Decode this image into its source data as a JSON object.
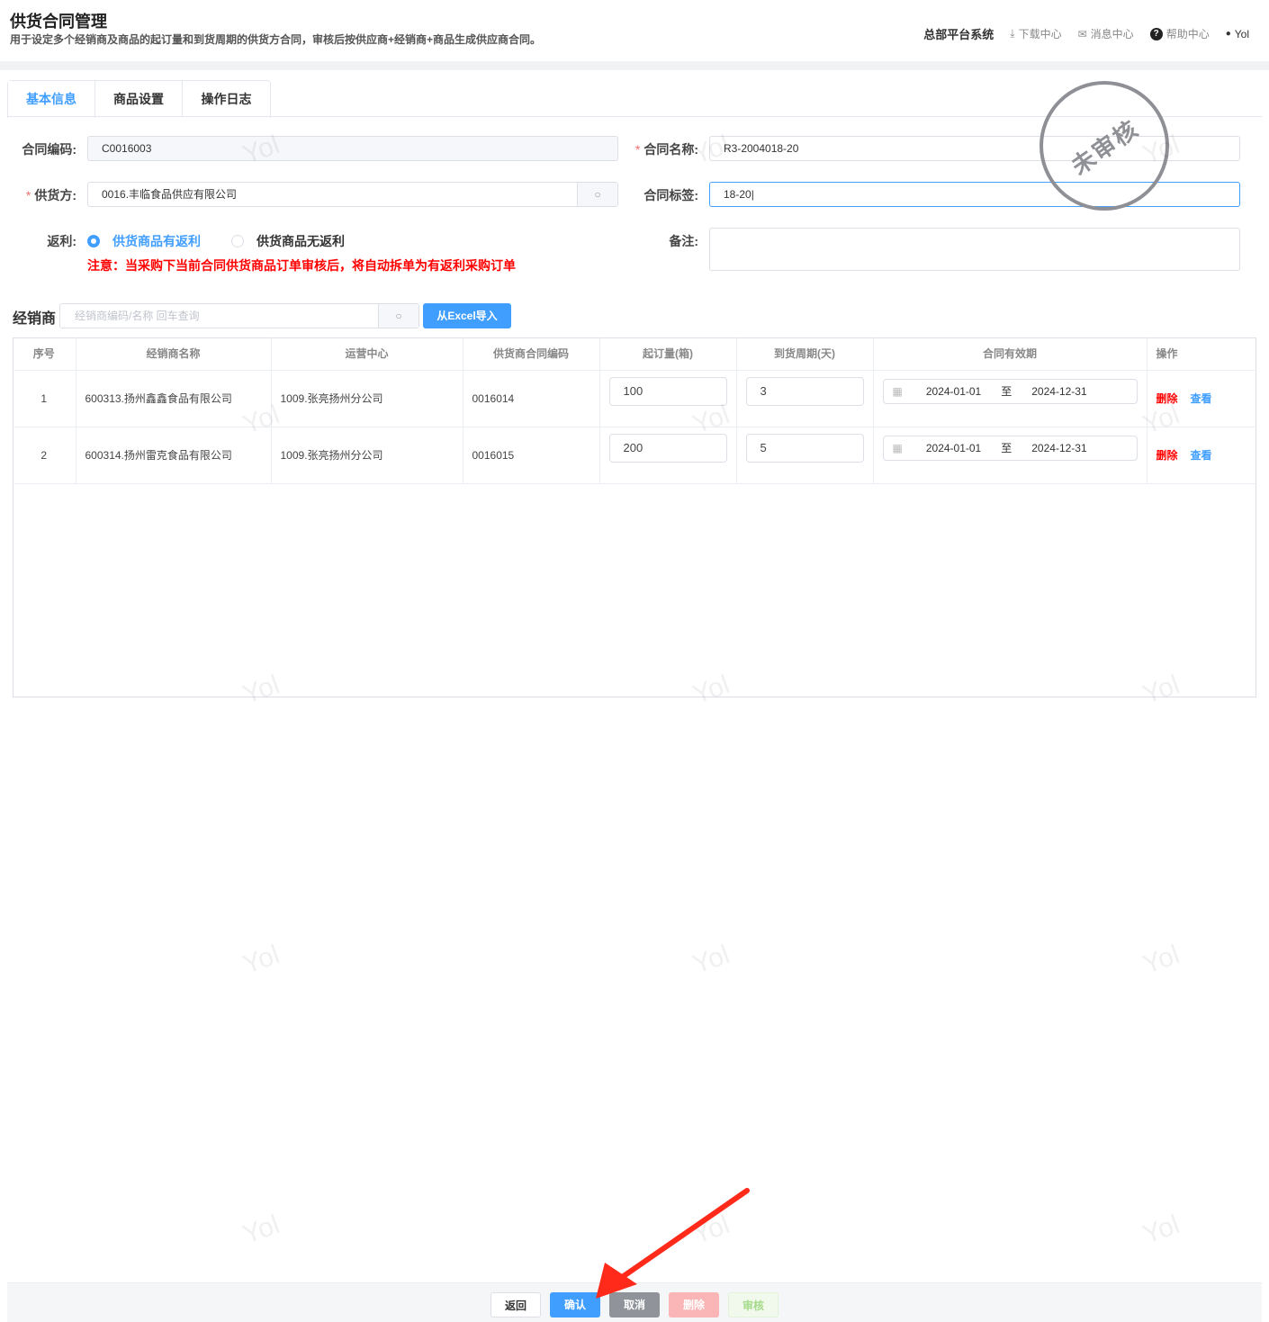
{
  "header": {
    "title": "供货合同管理",
    "subtitle": "用于设定多个经销商及商品的起订量和到货周期的供货方合同，审核后按供应商+经销商+商品生成供应商合同。",
    "system": "总部平台系统",
    "download": "下载中心",
    "messages": "消息中心",
    "help": "帮助中心",
    "user": "Yol"
  },
  "tabs": [
    "基本信息",
    "商品设置",
    "操作日志"
  ],
  "form": {
    "contract_code_label": "合同编码:",
    "contract_code": "C0016003",
    "contract_name_label": "合同名称:",
    "contract_name": "R3-2004018-20",
    "supplier_label": "供货方:",
    "supplier": "0016.丰临食品供应有限公司",
    "tag_label": "合同标签:",
    "tag": "18-20|",
    "rebate_label": "返利:",
    "rebate_yes": "供货商品有返利",
    "rebate_no": "供货商品无返利",
    "remark_label": "备注:",
    "remark": "",
    "note": "注意：当采购下当前合同供货商品订单审核后，将自动拆单为有返利采购订单"
  },
  "stamp": "未审核",
  "dealers": {
    "title": "经销商",
    "search_placeholder": "经销商编码/名称 回车查询",
    "import": "从Excel导入",
    "columns": [
      "序号",
      "经销商名称",
      "运营中心",
      "供货商合同编码",
      "起订量(箱)",
      "到货周期(天)",
      "合同有效期",
      "操作"
    ],
    "rows": [
      {
        "no": "1",
        "name": "600313.扬州鑫鑫食品有限公司",
        "center": "1009.张亮扬州分公司",
        "code": "0016014",
        "min": "100",
        "cycle": "3",
        "start": "2024-01-01",
        "to": "至",
        "end": "2024-12-31",
        "del": "删除",
        "view": "查看"
      },
      {
        "no": "2",
        "name": "600314.扬州雷克食品有限公司",
        "center": "1009.张亮扬州分公司",
        "code": "0016015",
        "min": "200",
        "cycle": "5",
        "start": "2024-01-01",
        "to": "至",
        "end": "2024-12-31",
        "del": "删除",
        "view": "查看"
      }
    ]
  },
  "footer": {
    "back": "返回",
    "confirm": "确认",
    "cancel": "取消",
    "delete": "删除",
    "audit": "审核"
  },
  "watermark": "Yol",
  "colors": {
    "primary": "#409eff",
    "danger": "#ff0000",
    "annotation": "#ff2a1a"
  }
}
